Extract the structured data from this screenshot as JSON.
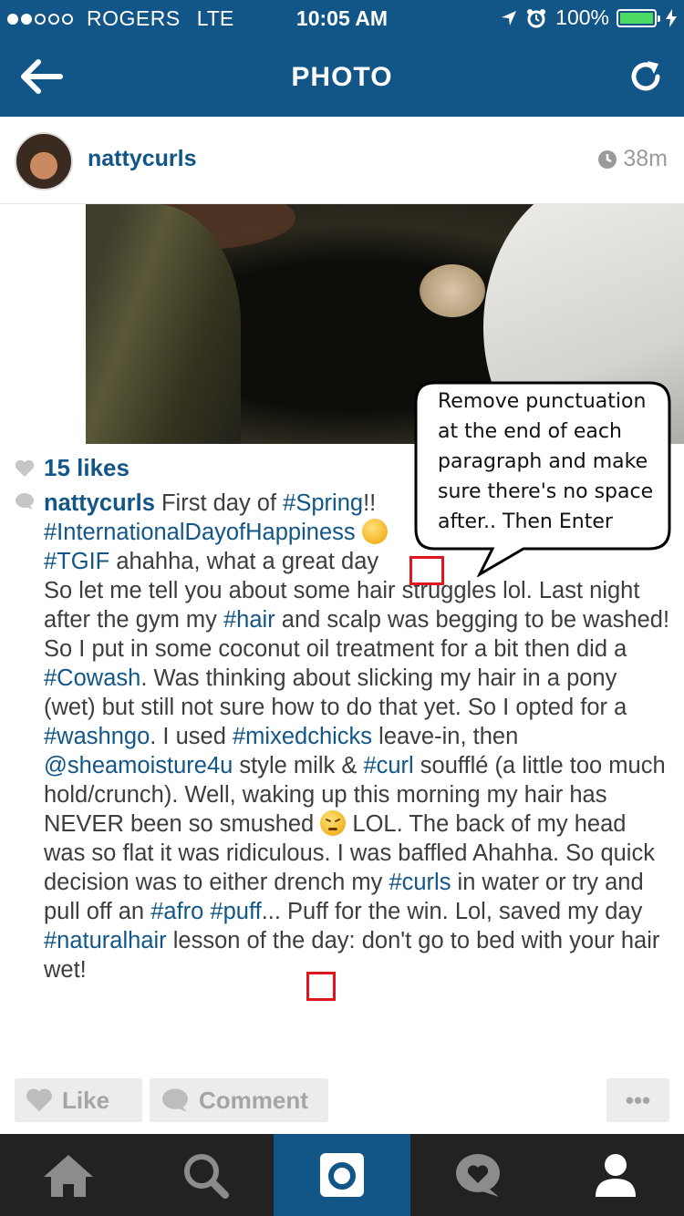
{
  "status_bar": {
    "carrier": "ROGERS",
    "network": "LTE",
    "time": "10:05 AM",
    "battery": "100%",
    "battery_level": 1.0,
    "signal_bars_on": 2,
    "signal_bars_total": 5
  },
  "nav": {
    "title": "PHOTO",
    "back_icon": "back-arrow-icon",
    "refresh_icon": "refresh-icon"
  },
  "post": {
    "username": "nattycurls",
    "time_ago": "38m",
    "likes": "15 likes",
    "caption": {
      "user": "nattycurls",
      "t1": " First day of ",
      "tag_spring": "#Spring",
      "t2": "!!",
      "tag_happiness": "#InternationalDayofHappiness",
      "tag_tgif": "#TGIF",
      "t3": " ahahha, what a great day",
      "t4": "So let me tell you about some hair struggles lol. Last night after the gym my ",
      "tag_hair": "#hair",
      "t5": " and scalp was begging to be washed! So I put in some coconut oil treatment for a bit then did a ",
      "tag_cowash": "#Cowash",
      "t6": ". Was thinking about slicking my hair in a pony (wet) but still not sure how to do that yet. So I opted for a ",
      "tag_washngo": "#washngo",
      "t7": ". I used ",
      "tag_mixedchicks": "#mixedchicks",
      "t8": " leave-in, then ",
      "mention_shea": "@sheamoisture4u",
      "t9": " style milk & ",
      "tag_curl": "#curl",
      "t10": " soufflé (a little too much hold/crunch). Well, waking up this morning my hair has NEVER been so smushed ",
      "t11": " LOL. The back of my head was so flat it was ridiculous. I was baffled Ahahha. So quick decision was to either drench my ",
      "tag_curls": "#curls",
      "t12": " in water or try and pull off an ",
      "tag_afro": "#afro",
      "t13": " ",
      "tag_puff": "#puff",
      "t14": "... Puff for the win. Lol, saved my day",
      "tag_naturalhair": "#naturalhair",
      "t15": " lesson of the day: don't go to bed with your hair wet!"
    }
  },
  "annotation": {
    "callout_text": "Remove punctuation at the end of each paragraph and make sure there's no space after.. Then Enter"
  },
  "actions": {
    "like": "Like",
    "comment": "Comment",
    "more": "•••"
  },
  "tabs": [
    "home-icon",
    "search-icon",
    "camera-icon",
    "activity-icon",
    "profile-icon"
  ],
  "colors": {
    "brand_blue": "#125688",
    "tab_bar": "#222222",
    "highlight_red": "#e1151c",
    "battery_green": "#4cd964"
  }
}
